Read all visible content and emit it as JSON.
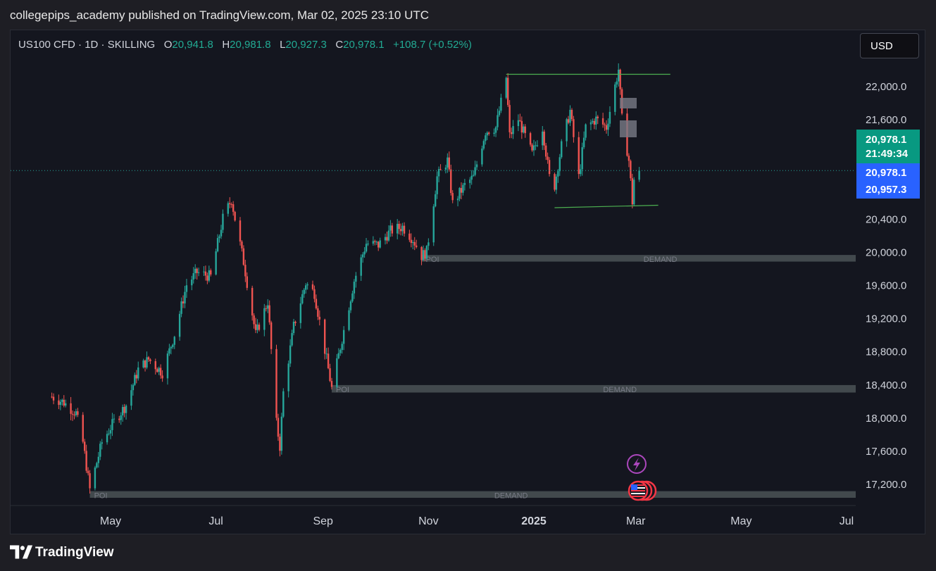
{
  "header": {
    "publisher_line": "collegepips_academy published on TradingView.com, Mar 02, 2025 23:10 UTC"
  },
  "symbol": {
    "title": "US100 CFD · 1D · SKILLING",
    "open_label": "O",
    "open": "20,941.8",
    "high_label": "H",
    "high": "20,981.8",
    "low_label": "L",
    "low": "20,927.3",
    "close_label": "C",
    "close": "20,978.1",
    "change": "+108.7 (+0.52%)"
  },
  "currency_button": "USD",
  "price_tags": {
    "last_price": "20,978.1",
    "countdown": "21:49:34",
    "bid": "20,978.1",
    "ask": "20,957.3",
    "last_color": "#089981",
    "bid_color": "#2962ff"
  },
  "footer": {
    "brand": "TradingView"
  },
  "colors": {
    "up": "#26a69a",
    "down": "#ef5350",
    "zone": "#4a5256",
    "trendline": "#4caf50"
  },
  "chart_data": {
    "type": "candlestick",
    "y_axis_ticks": [
      "22,000.0",
      "21,600.0",
      "20,400.0",
      "20,000.0",
      "19,600.0",
      "19,200.0",
      "18,800.0",
      "18,400.0",
      "18,000.0",
      "17,600.0",
      "17,200.0"
    ],
    "y_tick_values": [
      22000,
      21600,
      20400,
      20000,
      19600,
      19200,
      18800,
      18400,
      18000,
      17600,
      17200
    ],
    "ylim": [
      17050,
      22300
    ],
    "x_axis_labels": [
      "May",
      "Jul",
      "Sep",
      "Nov",
      "2025",
      "Mar",
      "May",
      "Jul"
    ],
    "x_label_dates": [
      "2024-05-01",
      "2024-07-01",
      "2024-09-01",
      "2024-11-01",
      "2025-01-01",
      "2025-03-01",
      "2025-05-01",
      "2025-07-01"
    ],
    "last_price": 20978.1,
    "demand_zones": [
      {
        "poi_label": "POI",
        "zone_label": "DEMAND",
        "start": "2024-10-28",
        "top": 19960,
        "bottom": 19880
      },
      {
        "poi_label": "POI",
        "zone_label": "DEMAND",
        "start": "2024-09-06",
        "top": 18390,
        "bottom": 18300
      },
      {
        "poi_label": "POI",
        "zone_label": "DEMAND",
        "start": "2024-04-19",
        "top": 17110,
        "bottom": 17030
      }
    ],
    "range_lines": [
      {
        "start": "2024-12-16",
        "end": "2025-03-21",
        "price": 22140
      },
      {
        "start": "2025-01-13",
        "end": "2025-03-14",
        "price": 20530,
        "end_price": 20560
      }
    ],
    "event_icons": [
      "lightning-icon",
      "us-flag-icon"
    ],
    "anchors": [
      [
        "2024-03-28",
        18250
      ],
      [
        "2024-04-04",
        18180
      ],
      [
        "2024-04-11",
        18050
      ],
      [
        "2024-04-15",
        17700
      ],
      [
        "2024-04-19",
        17130
      ],
      [
        "2024-04-26",
        17700
      ],
      [
        "2024-05-03",
        17950
      ],
      [
        "2024-05-10",
        18150
      ],
      [
        "2024-05-17",
        18580
      ],
      [
        "2024-05-23",
        18700
      ],
      [
        "2024-05-31",
        18540
      ],
      [
        "2024-06-07",
        19000
      ],
      [
        "2024-06-14",
        19600
      ],
      [
        "2024-06-20",
        19750
      ],
      [
        "2024-06-28",
        19700
      ],
      [
        "2024-07-05",
        20400
      ],
      [
        "2024-07-10",
        20630
      ],
      [
        "2024-07-12",
        20400
      ],
      [
        "2024-07-17",
        19880
      ],
      [
        "2024-07-24",
        19000
      ],
      [
        "2024-07-31",
        19400
      ],
      [
        "2024-08-05",
        17930
      ],
      [
        "2024-08-07",
        17650
      ],
      [
        "2024-08-09",
        18300
      ],
      [
        "2024-08-15",
        19100
      ],
      [
        "2024-08-22",
        19620
      ],
      [
        "2024-08-27",
        19500
      ],
      [
        "2024-09-03",
        18700
      ],
      [
        "2024-09-06",
        18350
      ],
      [
        "2024-09-13",
        19050
      ],
      [
        "2024-09-19",
        19650
      ],
      [
        "2024-09-26",
        20100
      ],
      [
        "2024-10-03",
        20080
      ],
      [
        "2024-10-10",
        20250
      ],
      [
        "2024-10-17",
        20300
      ],
      [
        "2024-10-23",
        20150
      ],
      [
        "2024-10-28",
        19950
      ],
      [
        "2024-10-31",
        20000
      ],
      [
        "2024-11-06",
        20900
      ],
      [
        "2024-11-12",
        21100
      ],
      [
        "2024-11-15",
        20580
      ],
      [
        "2024-11-22",
        20800
      ],
      [
        "2024-11-27",
        20900
      ],
      [
        "2024-12-04",
        21450
      ],
      [
        "2024-12-10",
        21500
      ],
      [
        "2024-12-16",
        22100
      ],
      [
        "2024-12-18",
        21400
      ],
      [
        "2024-12-23",
        21600
      ],
      [
        "2024-12-31",
        21180
      ],
      [
        "2025-01-06",
        21500
      ],
      [
        "2025-01-10",
        20900
      ],
      [
        "2025-01-13",
        20800
      ],
      [
        "2025-01-17",
        21280
      ],
      [
        "2025-01-22",
        21700
      ],
      [
        "2025-01-27",
        20900
      ],
      [
        "2025-01-31",
        21500
      ],
      [
        "2025-02-06",
        21600
      ],
      [
        "2025-02-12",
        21500
      ],
      [
        "2025-02-18",
        22100
      ],
      [
        "2025-02-19",
        22200
      ],
      [
        "2025-02-21",
        21600
      ],
      [
        "2025-02-25",
        21100
      ],
      [
        "2025-02-27",
        20600
      ],
      [
        "2025-02-28",
        20870
      ],
      [
        "2025-03-03",
        20978
      ]
    ]
  }
}
